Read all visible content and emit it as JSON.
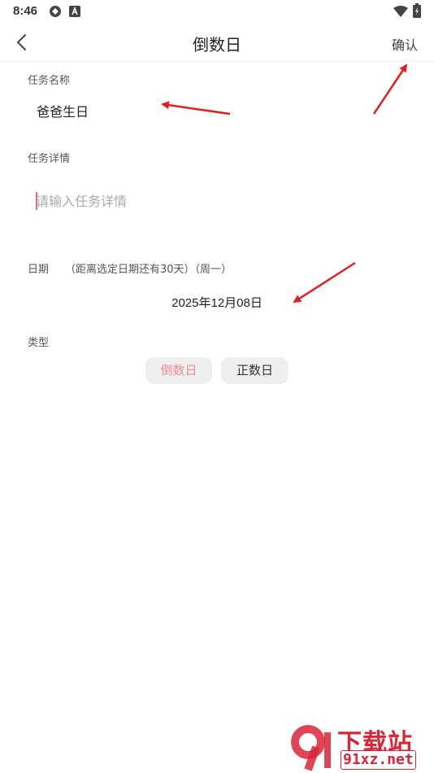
{
  "status_bar": {
    "time": "8:46",
    "icons": [
      "sync-icon",
      "app-a-icon",
      "wifi-icon",
      "battery-icon"
    ]
  },
  "header": {
    "back_icon": "chevron-left-icon",
    "title": "倒数日",
    "confirm_label": "确认"
  },
  "form": {
    "task_name": {
      "label": "任务名称",
      "value": "爸爸生日"
    },
    "task_detail": {
      "label": "任务详情",
      "placeholder": "请输入任务详情",
      "value": ""
    },
    "date": {
      "label": "日期",
      "hint": "（距离选定日期还有30天）（周一）",
      "value": "2025年12月08日"
    },
    "type": {
      "label": "类型",
      "options": [
        "倒数日",
        "正数日"
      ],
      "selected": "倒数日"
    }
  },
  "colors": {
    "selected_type_text": "#f28b94",
    "annotation_arrow": "#e02020",
    "watermark": "#d9253a"
  },
  "watermark": {
    "title": "下载站",
    "domain": "91xz.net"
  }
}
